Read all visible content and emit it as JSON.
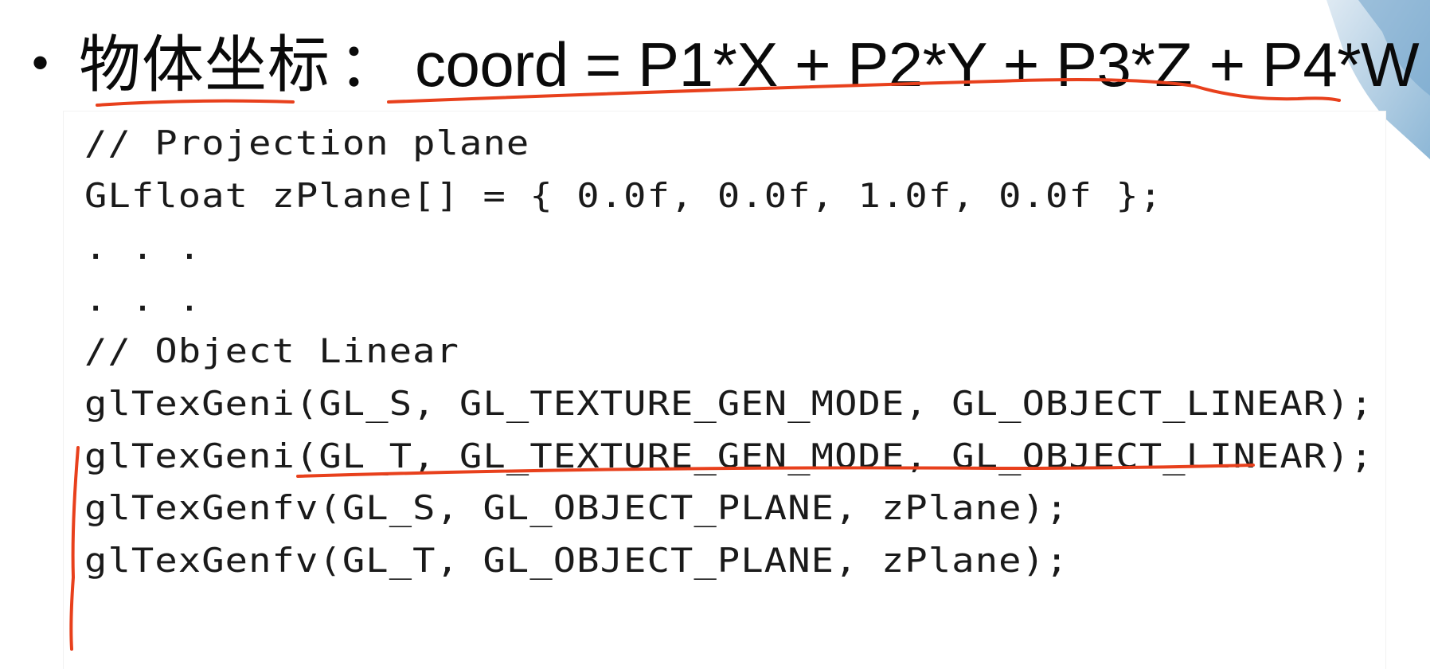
{
  "slide": {
    "bullet": "•",
    "title_label": "物体坐标",
    "title_separator": "：",
    "title_formula": "coord = P1*X + P2*Y + P3*Z + P4*W"
  },
  "code": {
    "lines": [
      "// Projection plane",
      "GLfloat zPlane[] = { 0.0f, 0.0f, 1.0f, 0.0f };",
      ". . .",
      ". . .",
      "// Object Linear",
      "glTexGeni(GL_S, GL_TEXTURE_GEN_MODE, GL_OBJECT_LINEAR);",
      "glTexGeni(GL_T, GL_TEXTURE_GEN_MODE, GL_OBJECT_LINEAR);",
      "glTexGenfv(GL_S, GL_OBJECT_PLANE, zPlane);",
      "glTexGenfv(GL_T, GL_OBJECT_PLANE, zPlane);"
    ]
  },
  "colors": {
    "annotation": "#e8401c",
    "text": "#0a0a0a",
    "decor": "#9fc3dc"
  }
}
